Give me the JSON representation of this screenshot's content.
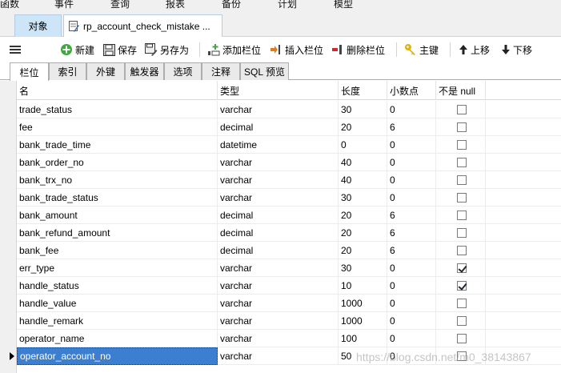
{
  "menu": [
    "函数",
    "事件",
    "查询",
    "报表",
    "备份",
    "计划",
    "模型"
  ],
  "tabs": {
    "objects": "对象",
    "design": "rp_account_check_mistake ..."
  },
  "toolbar": {
    "new": "新建",
    "save": "保存",
    "save_as": "另存为",
    "add_field": "添加栏位",
    "insert_field": "插入栏位",
    "delete_field": "删除栏位",
    "primary_key": "主键",
    "move_up": "上移",
    "move_down": "下移"
  },
  "subtabs": [
    "栏位",
    "索引",
    "外键",
    "触发器",
    "选项",
    "注释",
    "SQL 预览"
  ],
  "columns": {
    "name": "名",
    "type": "类型",
    "length": "长度",
    "decimals": "小数点",
    "not_null": "不是 null"
  },
  "rows": [
    {
      "name": "trade_status",
      "type": "varchar",
      "length": "30",
      "decimals": "0",
      "not_null": false
    },
    {
      "name": "fee",
      "type": "decimal",
      "length": "20",
      "decimals": "6",
      "not_null": false
    },
    {
      "name": "bank_trade_time",
      "type": "datetime",
      "length": "0",
      "decimals": "0",
      "not_null": false
    },
    {
      "name": "bank_order_no",
      "type": "varchar",
      "length": "40",
      "decimals": "0",
      "not_null": false
    },
    {
      "name": "bank_trx_no",
      "type": "varchar",
      "length": "40",
      "decimals": "0",
      "not_null": false
    },
    {
      "name": "bank_trade_status",
      "type": "varchar",
      "length": "30",
      "decimals": "0",
      "not_null": false
    },
    {
      "name": "bank_amount",
      "type": "decimal",
      "length": "20",
      "decimals": "6",
      "not_null": false
    },
    {
      "name": "bank_refund_amount",
      "type": "decimal",
      "length": "20",
      "decimals": "6",
      "not_null": false
    },
    {
      "name": "bank_fee",
      "type": "decimal",
      "length": "20",
      "decimals": "6",
      "not_null": false
    },
    {
      "name": "err_type",
      "type": "varchar",
      "length": "30",
      "decimals": "0",
      "not_null": true
    },
    {
      "name": "handle_status",
      "type": "varchar",
      "length": "10",
      "decimals": "0",
      "not_null": true
    },
    {
      "name": "handle_value",
      "type": "varchar",
      "length": "1000",
      "decimals": "0",
      "not_null": false
    },
    {
      "name": "handle_remark",
      "type": "varchar",
      "length": "1000",
      "decimals": "0",
      "not_null": false
    },
    {
      "name": "operator_name",
      "type": "varchar",
      "length": "100",
      "decimals": "0",
      "not_null": false
    },
    {
      "name": "operator_account_no",
      "type": "varchar",
      "length": "50",
      "decimals": "0",
      "not_null": false
    }
  ],
  "selected_row": 14,
  "watermark": "https://blog.csdn.net/m0_38143867",
  "colors": {
    "selection": "#3c7fd0",
    "tab_active": "#cde6f7"
  }
}
